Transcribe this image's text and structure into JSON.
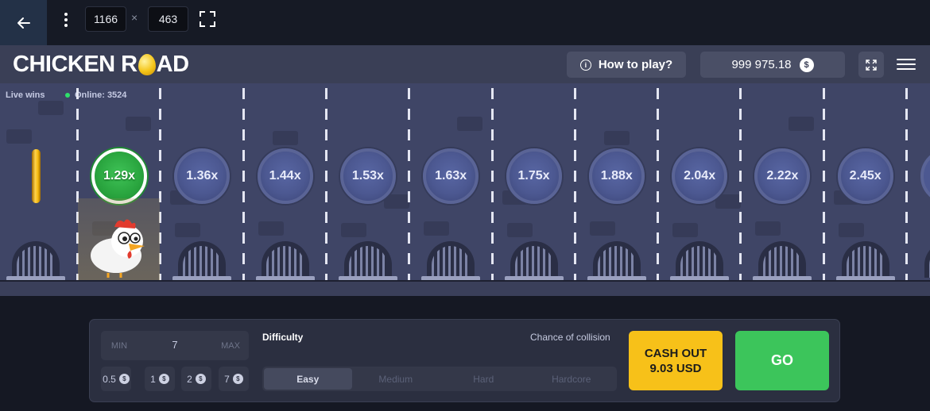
{
  "device_toolbar": {
    "width": "1166",
    "times": "×",
    "height": "463"
  },
  "header": {
    "logo_part1": "CHICKEN R",
    "logo_part2": "AD",
    "how_to_play": "How to play?",
    "balance": "999 975.18",
    "currency_symbol": "$"
  },
  "road": {
    "live_wins": "Live wins",
    "online": "Online: 3524",
    "multipliers": [
      {
        "label": "1.29x",
        "state": "current"
      },
      {
        "label": "1.36x",
        "state": "upcoming"
      },
      {
        "label": "1.44x",
        "state": "upcoming"
      },
      {
        "label": "1.53x",
        "state": "upcoming"
      },
      {
        "label": "1.63x",
        "state": "upcoming"
      },
      {
        "label": "1.75x",
        "state": "upcoming"
      },
      {
        "label": "1.88x",
        "state": "upcoming"
      },
      {
        "label": "2.04x",
        "state": "upcoming"
      },
      {
        "label": "2.22x",
        "state": "upcoming"
      },
      {
        "label": "2.45x",
        "state": "upcoming"
      }
    ]
  },
  "bet": {
    "min_label": "MIN",
    "value": "7",
    "max_label": "MAX",
    "quick_chips": [
      "0.5",
      "1",
      "2",
      "7"
    ],
    "chip_symbol": "$"
  },
  "difficulty": {
    "label": "Difficulty",
    "collision_label": "Chance of collision",
    "options": [
      "Easy",
      "Medium",
      "Hard",
      "Hardcore"
    ],
    "selected": "Easy"
  },
  "actions": {
    "cashout_line1": "CASH OUT",
    "cashout_line2": "9.03 USD",
    "go": "GO"
  },
  "colors": {
    "accent_yellow": "#f7c119",
    "accent_green": "#3cc55b",
    "road_bg": "#3f4566"
  }
}
